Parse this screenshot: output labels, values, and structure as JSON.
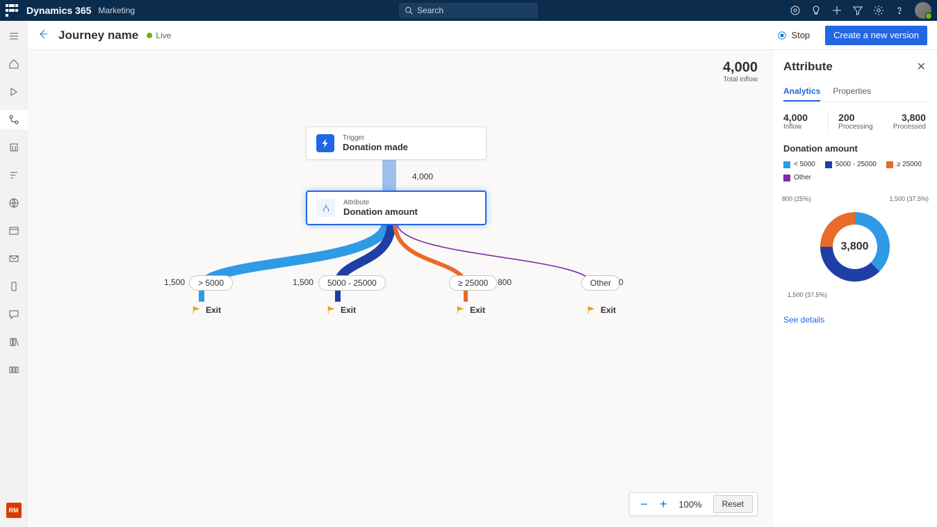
{
  "topbar": {
    "brand": "Dynamics 365",
    "module": "Marketing",
    "search_placeholder": "Search"
  },
  "cmdbar": {
    "title": "Journey name",
    "status": "Live",
    "stop": "Stop",
    "create": "Create a new version"
  },
  "leftnav": {
    "rm": "RM"
  },
  "canvas": {
    "total_inflow_value": "4,000",
    "total_inflow_label": "Total inflow",
    "trigger": {
      "label": "Trigger",
      "title": "Donation made"
    },
    "flow_count": "4,000",
    "attribute": {
      "label": "Attribute",
      "title": "Donation amount"
    },
    "branches": [
      {
        "label": "> 5000",
        "count": "1,500",
        "exit": "Exit",
        "color": "#2f9ae6"
      },
      {
        "label": "5000 - 25000",
        "count": "1,500",
        "exit": "Exit",
        "color": "#1f3fa6"
      },
      {
        "label": "≥ 25000",
        "count": "800",
        "exit": "Exit",
        "color": "#e86b2a"
      },
      {
        "label": "Other",
        "count": "0",
        "exit": "Exit",
        "color": "#7b2fa6"
      }
    ]
  },
  "zoom": {
    "value": "100%",
    "reset": "Reset"
  },
  "panel": {
    "title": "Attribute",
    "tabs": {
      "analytics": "Analytics",
      "properties": "Properties"
    },
    "metrics": {
      "inflow_v": "4,000",
      "inflow_l": "Inflow",
      "proc_v": "200",
      "proc_l": "Processing",
      "done_v": "3,800",
      "done_l": "Processed"
    },
    "chart_title": "Donation amount",
    "legend": [
      {
        "label": "< 5000",
        "color": "#2f9ae6"
      },
      {
        "label": "5000 - 25000",
        "color": "#1f3fa6"
      },
      {
        "label": "≥ 25000",
        "color": "#e86b2a"
      },
      {
        "label": "Other",
        "color": "#7b2fa6"
      }
    ],
    "donut_center": "3,800",
    "donut_labels": {
      "a": "1,500 (37.5%)",
      "b": "1,500 (37.5%)",
      "c": "800 (25%)"
    },
    "see_details": "See details"
  },
  "chart_data": {
    "type": "pie",
    "title": "Donation amount",
    "total": 3800,
    "series": [
      {
        "name": "< 5000",
        "value": 1500,
        "pct": 37.5,
        "color": "#2f9ae6"
      },
      {
        "name": "5000 - 25000",
        "value": 1500,
        "pct": 37.5,
        "color": "#1f3fa6"
      },
      {
        "name": "≥ 25000",
        "value": 800,
        "pct": 25.0,
        "color": "#e86b2a"
      },
      {
        "name": "Other",
        "value": 0,
        "pct": 0.0,
        "color": "#7b2fa6"
      }
    ]
  }
}
